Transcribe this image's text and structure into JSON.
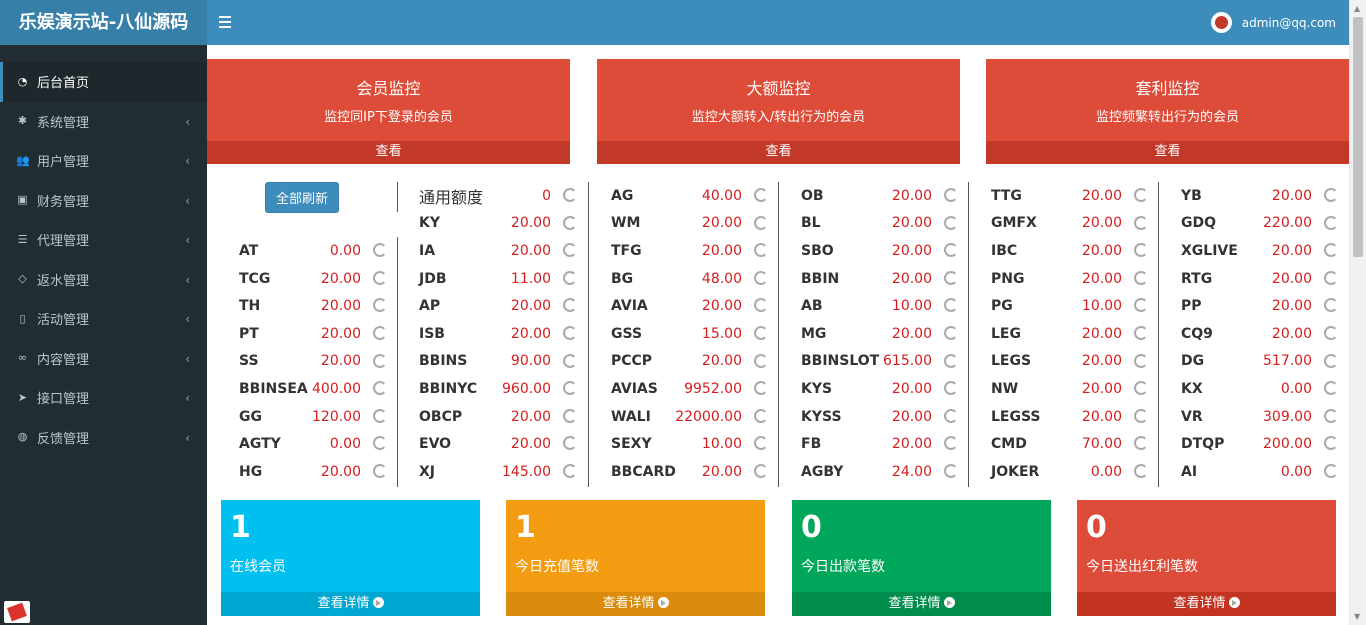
{
  "app": {
    "title": "乐娱演示站-八仙源码",
    "user_email": "admin@qq.com"
  },
  "icons": {
    "menu": "hamburger-icon",
    "avatar": "avatar-icon",
    "refresh": "refresh-icon",
    "chevron": "chevron-left-icon",
    "arrow": "arrow-circle-right-icon"
  },
  "sidebar": {
    "items": [
      {
        "label": "后台首页",
        "icon": "dashboard-icon",
        "active": true
      },
      {
        "label": "系统管理",
        "icon": "gear-icon"
      },
      {
        "label": "用户管理",
        "icon": "users-icon"
      },
      {
        "label": "财务管理",
        "icon": "money-icon"
      },
      {
        "label": "代理管理",
        "icon": "list-icon"
      },
      {
        "label": "返水管理",
        "icon": "code-icon"
      },
      {
        "label": "活动管理",
        "icon": "map-icon"
      },
      {
        "label": "内容管理",
        "icon": "link-icon"
      },
      {
        "label": "接口管理",
        "icon": "send-icon"
      },
      {
        "label": "反馈管理",
        "icon": "comments-icon"
      }
    ]
  },
  "monitors": [
    {
      "title": "会员监控",
      "desc": "监控同IP下登录的会员",
      "link": "查看"
    },
    {
      "title": "大额监控",
      "desc": "监控大额转入/转出行为的会员",
      "link": "查看"
    },
    {
      "title": "套利监控",
      "desc": "监控频繁转出行为的会员",
      "link": "查看"
    }
  ],
  "balances": {
    "refresh_all": "全部刷新",
    "general_label": "通用额度",
    "general_value": "0",
    "columns": [
      [
        [
          "AT",
          "0.00"
        ],
        [
          "TCG",
          "20.00"
        ],
        [
          "TH",
          "20.00"
        ],
        [
          "PT",
          "20.00"
        ],
        [
          "SS",
          "20.00"
        ],
        [
          "BBINSEA",
          "400.00"
        ],
        [
          "GG",
          "120.00"
        ],
        [
          "AGTY",
          "0.00"
        ],
        [
          "HG",
          "20.00"
        ]
      ],
      [
        [
          "KY",
          "20.00"
        ],
        [
          "IA",
          "20.00"
        ],
        [
          "JDB",
          "11.00"
        ],
        [
          "AP",
          "20.00"
        ],
        [
          "ISB",
          "20.00"
        ],
        [
          "BBINS",
          "90.00"
        ],
        [
          "BBINYC",
          "960.00"
        ],
        [
          "OBCP",
          "20.00"
        ],
        [
          "EVO",
          "20.00"
        ],
        [
          "XJ",
          "145.00"
        ]
      ],
      [
        [
          "AG",
          "40.00"
        ],
        [
          "WM",
          "20.00"
        ],
        [
          "TFG",
          "20.00"
        ],
        [
          "BG",
          "48.00"
        ],
        [
          "AVIA",
          "20.00"
        ],
        [
          "GSS",
          "15.00"
        ],
        [
          "PCCP",
          "20.00"
        ],
        [
          "AVIAS",
          "9952.00"
        ],
        [
          "WALI",
          "22000.00"
        ],
        [
          "SEXY",
          "10.00"
        ],
        [
          "BBCARD",
          "20.00"
        ]
      ],
      [
        [
          "OB",
          "20.00"
        ],
        [
          "BL",
          "20.00"
        ],
        [
          "SBO",
          "20.00"
        ],
        [
          "BBIN",
          "20.00"
        ],
        [
          "AB",
          "10.00"
        ],
        [
          "MG",
          "20.00"
        ],
        [
          "BBINSLOT",
          "615.00"
        ],
        [
          "KYS",
          "20.00"
        ],
        [
          "KYSS",
          "20.00"
        ],
        [
          "FB",
          "20.00"
        ],
        [
          "AGBY",
          "24.00"
        ]
      ],
      [
        [
          "TTG",
          "20.00"
        ],
        [
          "GMFX",
          "20.00"
        ],
        [
          "IBC",
          "20.00"
        ],
        [
          "PNG",
          "20.00"
        ],
        [
          "PG",
          "10.00"
        ],
        [
          "LEG",
          "20.00"
        ],
        [
          "LEGS",
          "20.00"
        ],
        [
          "NW",
          "20.00"
        ],
        [
          "LEGSS",
          "20.00"
        ],
        [
          "CMD",
          "70.00"
        ],
        [
          "JOKER",
          "0.00"
        ]
      ],
      [
        [
          "YB",
          "20.00"
        ],
        [
          "GDQ",
          "220.00"
        ],
        [
          "XGLIVE",
          "20.00"
        ],
        [
          "RTG",
          "20.00"
        ],
        [
          "PP",
          "20.00"
        ],
        [
          "CQ9",
          "20.00"
        ],
        [
          "DG",
          "517.00"
        ],
        [
          "KX",
          "0.00"
        ],
        [
          "VR",
          "309.00"
        ],
        [
          "DTQP",
          "200.00"
        ],
        [
          "AI",
          "0.00"
        ]
      ]
    ]
  },
  "stats": [
    {
      "value": "1",
      "label": "在线会员",
      "more": "查看详情",
      "color": "#00c0ef",
      "footer_color": "#00a7d0"
    },
    {
      "value": "1",
      "label": "今日充值笔数",
      "more": "查看详情",
      "color": "#f39c12",
      "footer_color": "#db8b0b"
    },
    {
      "value": "0",
      "label": "今日出款笔数",
      "more": "查看详情",
      "color": "#00a65a",
      "footer_color": "#008d4c"
    },
    {
      "value": "0",
      "label": "今日送出红利笔数",
      "more": "查看详情",
      "color": "#dd4b39",
      "footer_color": "#c23321"
    }
  ]
}
